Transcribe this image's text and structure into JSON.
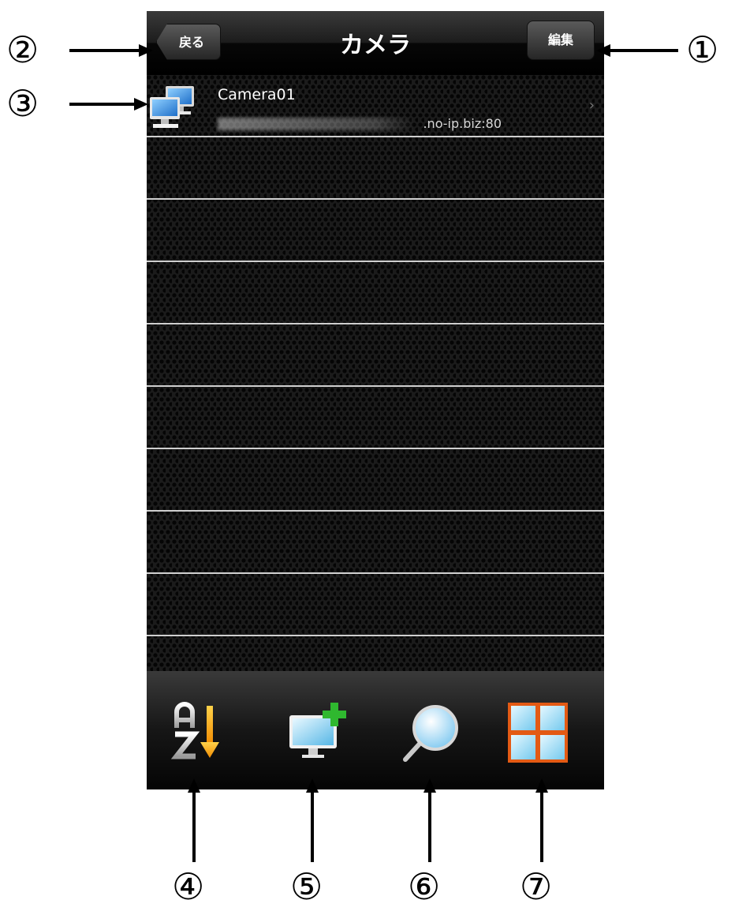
{
  "nav": {
    "title": "カメラ",
    "back_label": "戻る",
    "edit_label": "編集"
  },
  "cameras": [
    {
      "name": "Camera01",
      "address": ".no-ip.biz:80"
    }
  ],
  "toolbar": {
    "items": [
      {
        "icon": "sort-az-icon"
      },
      {
        "icon": "add-camera-icon"
      },
      {
        "icon": "search-icon"
      },
      {
        "icon": "grid-view-icon"
      }
    ]
  },
  "callouts": [
    "①",
    "②",
    "③",
    "④",
    "⑤",
    "⑥",
    "⑦"
  ]
}
